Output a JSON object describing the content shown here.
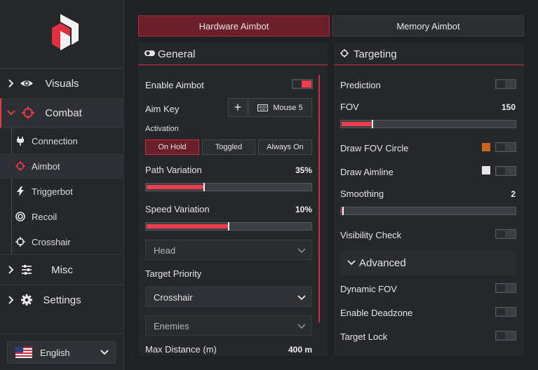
{
  "sidebar": {
    "nav": [
      {
        "label": "Visuals",
        "icon": "eye-icon"
      },
      {
        "label": "Combat",
        "icon": "crosshair-icon"
      },
      {
        "label": "Misc",
        "icon": "sliders-icon"
      },
      {
        "label": "Settings",
        "icon": "gear-icon"
      }
    ],
    "sub": [
      {
        "label": "Connection",
        "icon": "plug-icon"
      },
      {
        "label": "Aimbot",
        "icon": "crosshair-icon"
      },
      {
        "label": "Triggerbot",
        "icon": "bolt-icon"
      },
      {
        "label": "Recoil",
        "icon": "target-icon"
      },
      {
        "label": "Crosshair",
        "icon": "crosshair-icon"
      }
    ],
    "language": "English"
  },
  "tabs": [
    {
      "label": "Hardware Aimbot",
      "active": true
    },
    {
      "label": "Memory Aimbot",
      "active": false
    }
  ],
  "general": {
    "title": "General",
    "enable_aimbot": {
      "label": "Enable Aimbot",
      "on": true
    },
    "aim_key": {
      "label": "Aim Key",
      "add": "+",
      "key": "Mouse 5"
    },
    "activation": {
      "label": "Activation",
      "options": [
        "On Hold",
        "Toggled",
        "Always On"
      ],
      "selected": "On Hold"
    },
    "path_variation": {
      "label": "Path Variation",
      "value": "35%",
      "fraction": 0.35
    },
    "speed_variation": {
      "label": "Speed Variation",
      "value": "10%",
      "fraction": 0.5
    },
    "bone_select": "Head",
    "target_priority": {
      "label": "Target Priority",
      "value": "Crosshair"
    },
    "target_filter": "Enemies",
    "max_distance": {
      "label": "Max Distance (m)",
      "value": "400 m"
    }
  },
  "targeting": {
    "title": "Targeting",
    "prediction": {
      "label": "Prediction",
      "on": false
    },
    "fov": {
      "label": "FOV",
      "value": "150",
      "fraction": 0.18
    },
    "draw_fov_circle": {
      "label": "Draw FOV Circle",
      "on": false,
      "color": "#c8641e"
    },
    "draw_aimline": {
      "label": "Draw Aimline",
      "on": false,
      "color": "#e6e6e6"
    },
    "smoothing": {
      "label": "Smoothing",
      "value": "2",
      "fraction": 0.01
    },
    "visibility_check": {
      "label": "Visibility Check",
      "on": false
    },
    "advanced": "Advanced",
    "dynamic_fov": {
      "label": "Dynamic FOV",
      "on": false
    },
    "enable_deadzone": {
      "label": "Enable Deadzone",
      "on": false
    },
    "target_lock": {
      "label": "Target Lock",
      "on": false
    }
  },
  "colors": {
    "accent": "#ef3d4f",
    "background": "#202124",
    "panel": "#26272b"
  }
}
